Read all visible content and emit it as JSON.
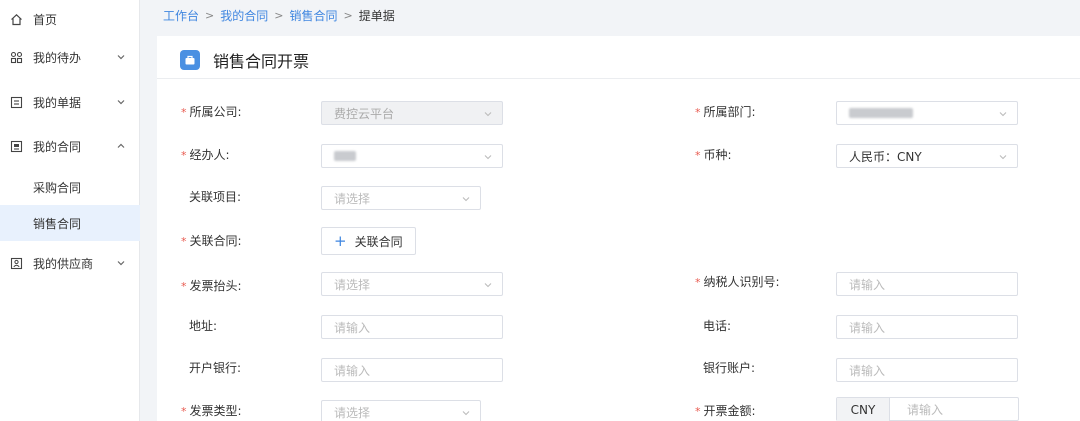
{
  "sidebar": {
    "items": [
      {
        "label": "首页",
        "icon": "home-icon"
      },
      {
        "label": "我的待办",
        "icon": "grid-icon"
      },
      {
        "label": "我的单据",
        "icon": "document-icon"
      },
      {
        "label": "我的合同",
        "icon": "contract-icon"
      },
      {
        "label": "我的供应商",
        "icon": "supplier-icon"
      }
    ],
    "contract_sub": [
      {
        "label": "采购合同"
      },
      {
        "label": "销售合同",
        "active": true
      }
    ]
  },
  "breadcrumb": [
    "工作台",
    "我的合同",
    "销售合同",
    "提单据"
  ],
  "page": {
    "title": "销售合同开票",
    "accent_color": "#4a90e2"
  },
  "form": {
    "company": {
      "label": "所属公司:",
      "value": "费控云平台",
      "required": true
    },
    "department": {
      "label": "所属部门:",
      "value": "",
      "required": true
    },
    "handler": {
      "label": "经办人:",
      "value": "",
      "required": true
    },
    "currency": {
      "label": "币种:",
      "value": "人民币：CNY",
      "required": true
    },
    "project": {
      "label": "关联项目:",
      "placeholder": "请选择"
    },
    "contract": {
      "label": "关联合同:",
      "button": "关联合同",
      "required": true
    },
    "invoice_header": {
      "label": "发票抬头:",
      "placeholder": "请选择",
      "required": true
    },
    "tax_id": {
      "label": "纳税人识别号:",
      "placeholder": "请输入",
      "required": true
    },
    "address": {
      "label": "地址:",
      "placeholder": "请输入"
    },
    "phone": {
      "label": "电话:",
      "placeholder": "请输入"
    },
    "bank": {
      "label": "开户银行:",
      "placeholder": "请输入"
    },
    "account": {
      "label": "银行账户:",
      "placeholder": "请输入"
    },
    "invoice_type": {
      "label": "发票类型:",
      "placeholder": "请选择",
      "required": true
    },
    "amount": {
      "label": "开票金额:",
      "prefix": "CNY",
      "placeholder": "请输入",
      "required": true
    }
  }
}
